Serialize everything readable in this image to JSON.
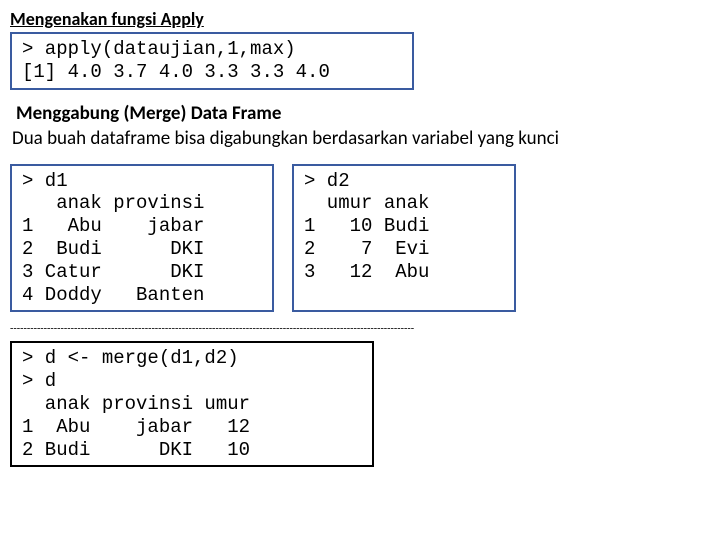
{
  "heading1": "Mengenakan fungsi Apply",
  "code1": "> apply(dataujian,1,max)\n[1] 4.0 3.7 4.0 3.3 3.3 4.0",
  "heading2": "Menggabung (Merge) Data Frame",
  "body1": "Dua buah dataframe bisa digabungkan berdasarkan variabel yang kunci",
  "code_d1": "> d1\n   anak provinsi\n1   Abu    jabar\n2  Budi      DKI\n3 Catur      DKI\n4 Doddy   Banten",
  "code_d2": "> d2\n  umur anak\n1   10 Budi\n2    7  Evi\n3   12  Abu",
  "dashes": "------------------------------------------------------------------------------------------------------------------------",
  "code_merge": "> d <- merge(d1,d2)\n> d\n  anak provinsi umur\n1  Abu    jabar   12\n2 Budi      DKI   10"
}
